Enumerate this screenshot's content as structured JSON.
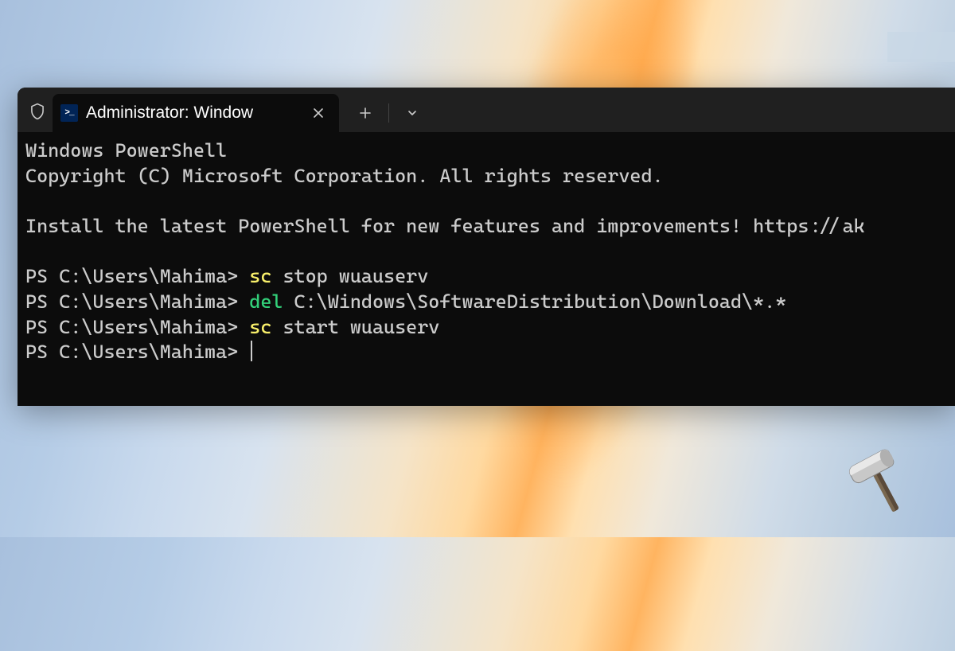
{
  "tab": {
    "title": "Administrator: Window"
  },
  "terminal": {
    "header_line1": "Windows PowerShell",
    "header_line2": "Copyright (C) Microsoft Corporation. All rights reserved.",
    "install_msg": "Install the latest PowerShell for new features and improvements! https://ak",
    "prompt": "PS C:\\Users\\Mahima> ",
    "commands": [
      {
        "cmd": "sc",
        "args": " stop wuauserv"
      },
      {
        "cmd": "del",
        "args": " C:\\Windows\\SoftwareDistribution\\Download\\*.*"
      },
      {
        "cmd": "sc",
        "args": " start wuauserv"
      }
    ]
  },
  "icons": {
    "shield": "shield-icon",
    "powershell": "powershell-icon",
    "close": "close-icon",
    "new_tab": "plus-icon",
    "dropdown": "chevron-down-icon",
    "hammer": "hammer-icon"
  }
}
